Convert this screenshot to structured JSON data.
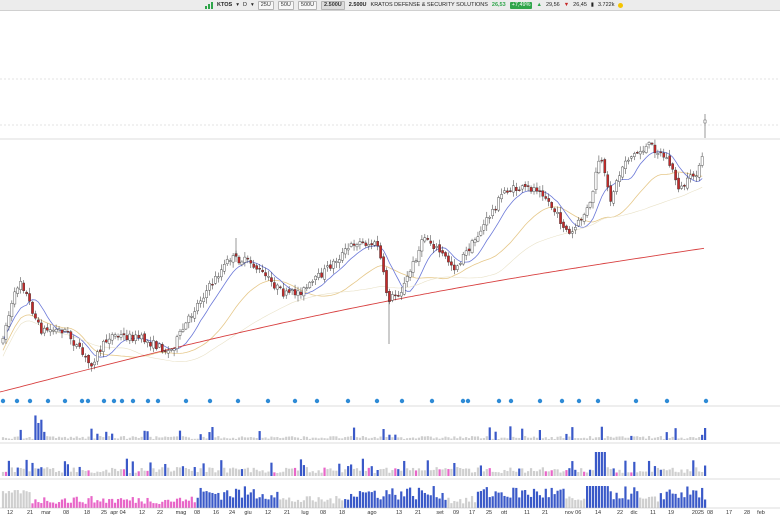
{
  "toolbar": {
    "ticker": "KTOS",
    "period_menu": "D",
    "bar_options": [
      "25U",
      "50U",
      "500U",
      "2.500U"
    ],
    "selected_bar_option": "2.500U",
    "company_name": "KRATOS DEFENSE & SECURITY SOLUTIONS",
    "last_price": "26,53",
    "change_pct": "+7,49%",
    "stat1": "29,56",
    "stat2": "26,45",
    "stat3": "3.722k",
    "status_color": "#f5c400",
    "icons": [
      "chart-icon",
      "chevron-down-icon",
      "chevron-down-icon",
      "status-dot-icon"
    ]
  },
  "chart_data": {
    "type": "candlestick",
    "series": [
      "price",
      "sma-fast",
      "sma-mid",
      "sma-slow"
    ],
    "colors": {
      "up": "#ffffff",
      "down": "#c62828",
      "sma_fast": "#6b78d8",
      "sma_mid": "#e6c88a",
      "sma_slow": "#d84040",
      "volume": "#3a59c8",
      "volume_low": "#cfcfcf",
      "volume_pink": "#e866c8",
      "marker": "#2e8bd6"
    },
    "x_tick_labels": [
      "12",
      "21",
      "mar",
      "08",
      "18",
      "25",
      "apr 04",
      "12",
      "22",
      "mag",
      "08",
      "16",
      "24",
      "giu",
      "12",
      "21",
      "lug",
      "08",
      "18",
      "ago",
      "13",
      "21",
      "set",
      "09",
      "17",
      "25",
      "ott",
      "11",
      "21",
      "nov 06",
      "14",
      "22",
      "dic",
      "11",
      "19",
      "2025",
      "08",
      "17",
      "28",
      "feb"
    ],
    "grid": false,
    "legend": "none"
  }
}
